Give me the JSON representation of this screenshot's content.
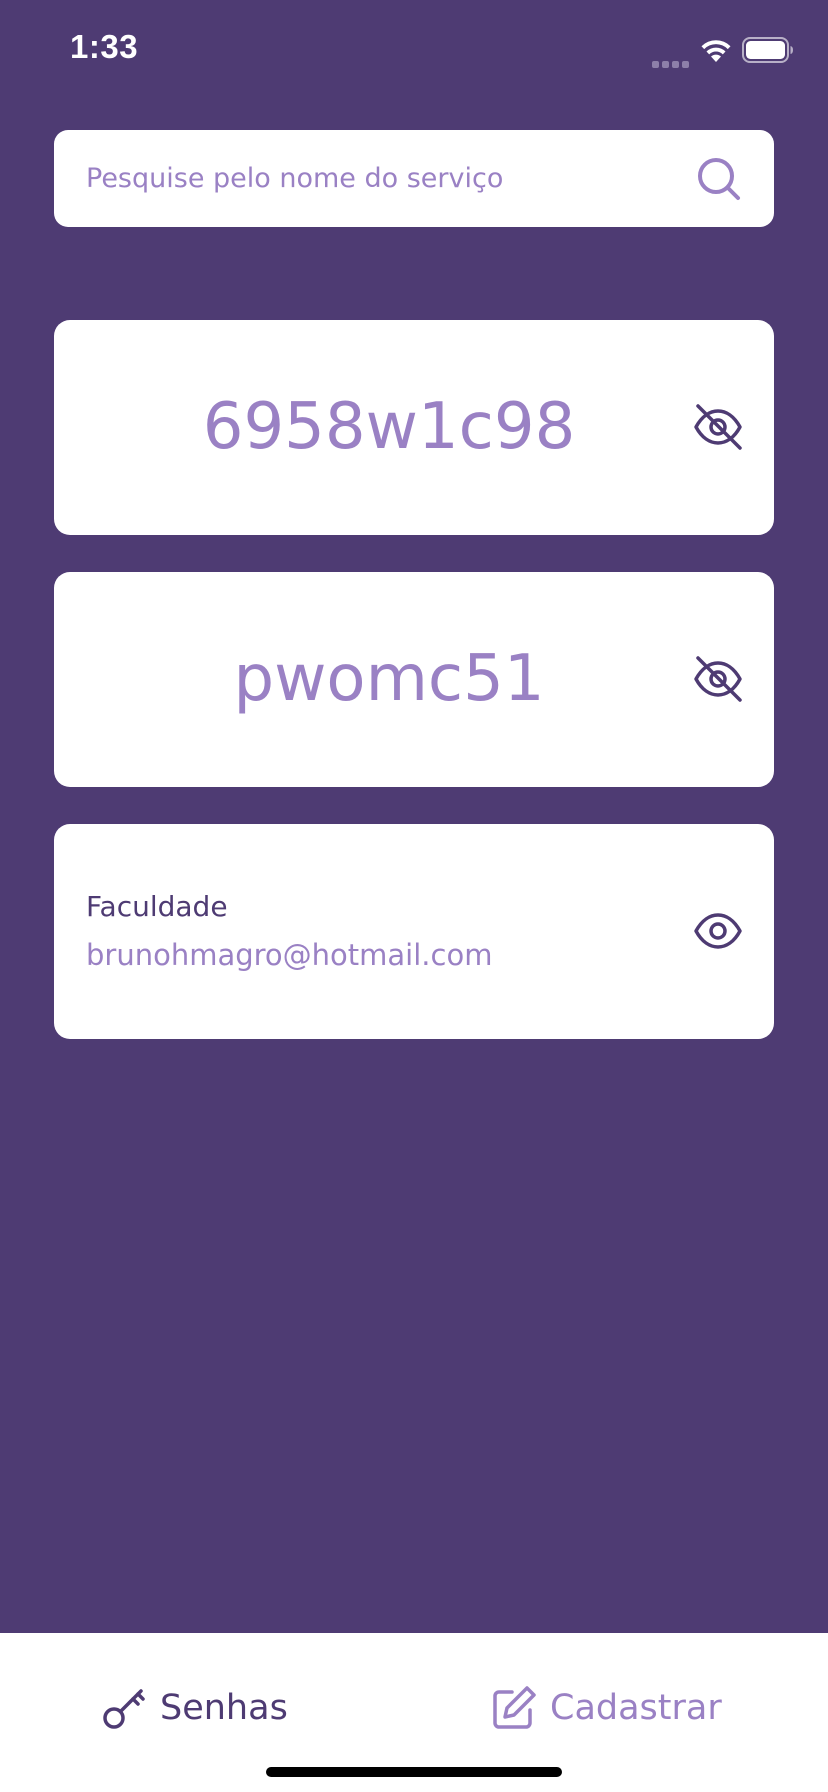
{
  "status_bar": {
    "time": "1:33"
  },
  "search": {
    "placeholder": "Pesquise pelo nome do serviço",
    "icon": "search-icon"
  },
  "cards": [
    {
      "password": "6958w1c98",
      "visibility_icon": "eye-off-icon"
    },
    {
      "password": "pwomc51",
      "visibility_icon": "eye-off-icon"
    },
    {
      "service": "Faculdade",
      "email": "brunohmagro@hotmail.com",
      "visibility_icon": "eye-icon"
    }
  ],
  "tabs": [
    {
      "label": "Senhas",
      "icon": "key-icon",
      "active": true
    },
    {
      "label": "Cadastrar",
      "icon": "edit-icon",
      "active": false
    }
  ],
  "colors": {
    "background": "#4e3b73",
    "accent": "#9a81c4",
    "dark": "#4e3b73",
    "surface": "#ffffff"
  }
}
